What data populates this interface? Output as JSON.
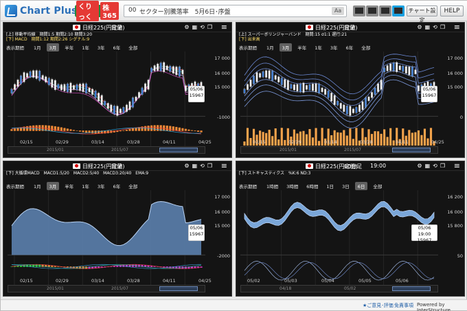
{
  "app": {
    "brand": "Chart Plus",
    "badge_prefix": "くりっく",
    "badge": "株365"
  },
  "search": {
    "code": "00",
    "text": "セクター別騰落率　5月6日･序盤",
    "aa": "Aa"
  },
  "buttons": {
    "chart_setting": "チャート設定",
    "help": "HELP"
  },
  "panels": [
    {
      "title": "日経225(円定値)",
      "interval": "日足",
      "params": [
        "[上] 移動平均線　期間1:5 期間2:10 期間3:20",
        "[下] MACD　期間1:12 期間2:26 シグナル:9"
      ],
      "period_label": "表示期間",
      "periods": [
        "1月",
        "3月",
        "半年",
        "1年",
        "3年",
        "6年",
        "全部"
      ],
      "selected_period": "3月",
      "x_ticks": [
        "02/15",
        "02/29",
        "03/14",
        "03/28",
        "04/11",
        "04/25"
      ],
      "y_ticks": [
        "17 000",
        "16 000",
        "15 000",
        "-1000"
      ],
      "nav": [
        "2015/01",
        "2015/07",
        "2016/01"
      ],
      "tooltip": [
        "05/06",
        "15967"
      ]
    },
    {
      "title": "日経225(円定値)",
      "interval": "日足",
      "params": [
        "[上] スーパーボリンジャーバンド　期間:15 σ1:1 遅行:21",
        "[下] 出来高"
      ],
      "period_label": "表示期間",
      "periods": [
        "1月",
        "3月",
        "半年",
        "1年",
        "3年",
        "6年",
        "全部"
      ],
      "selected_period": "3月",
      "x_ticks": [
        "02/15",
        "02/29",
        "03/14",
        "03/28",
        "04/11",
        "04/25"
      ],
      "y_ticks": [
        "17 000",
        "16 000",
        "15 000",
        "0"
      ],
      "nav": [
        "2015/01",
        "2015/07",
        "2016/01"
      ],
      "tooltip": [
        "05/06",
        "15967"
      ]
    },
    {
      "title": "日経225(円定値)",
      "interval": "日足",
      "params": [
        "[下] 大循環MACD　MACD1:5/20　MACD2:5/40　MACD3:20/40　EMA:9"
      ],
      "period_label": "表示期間",
      "periods": [
        "1月",
        "3月",
        "半年",
        "1年",
        "3年",
        "6年",
        "全部"
      ],
      "selected_period": "3月",
      "x_ticks": [
        "02/15",
        "02/29",
        "03/14",
        "03/28",
        "04/11",
        "04/25"
      ],
      "y_ticks": [
        "17 000",
        "16 000",
        "15 000",
        "-2000"
      ],
      "nav": [
        "2015/01",
        "2015/07",
        "2016/01"
      ],
      "tooltip": [
        "05/06",
        "15967"
      ]
    },
    {
      "title": "日経225(円定値)",
      "interval": "60分足",
      "time": "19:00",
      "params": [
        "[下] ストキャスティクス　%K:6 ND:3"
      ],
      "period_label": "表示期間",
      "periods": [
        "1時間",
        "3時間",
        "6時間",
        "1日",
        "3日",
        "6日",
        "全部"
      ],
      "selected_period": "6日",
      "x_ticks": [
        "05/02",
        "05/03",
        "05/04",
        "05/05",
        "05/06"
      ],
      "y_ticks": [
        "16 200",
        "16 000",
        "15 800",
        "50"
      ],
      "nav": [
        "04/18",
        "05/02"
      ],
      "tooltip": [
        "05/06 19:00",
        "15967"
      ]
    }
  ],
  "footer": {
    "feedback": "★ご意見･評価",
    "disclaimer": "免責事項",
    "powered": "Powered by InterStructure"
  },
  "colors": {
    "accent": "#1aa0e0",
    "candle_up": "#f2f2f2",
    "candle_down": "#3a7bd5",
    "area_fill": "#7aa6d8",
    "macd_bar": "#f28a36",
    "volume": "#f2a24b"
  }
}
